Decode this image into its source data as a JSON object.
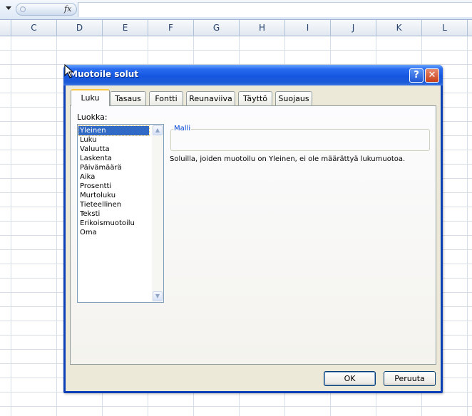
{
  "formula_bar": {
    "fx_label": "fx",
    "value": ""
  },
  "columns": [
    {
      "label": "C"
    },
    {
      "label": "D"
    },
    {
      "label": "E"
    },
    {
      "label": "F"
    },
    {
      "label": "G"
    },
    {
      "label": "H"
    },
    {
      "label": "I"
    },
    {
      "label": "J"
    },
    {
      "label": "K"
    },
    {
      "label": "L"
    }
  ],
  "dialog": {
    "title": "Muotoile solut",
    "help_glyph": "?",
    "close_glyph": "✕",
    "tabs": [
      {
        "label": "Luku"
      },
      {
        "label": "Tasaus"
      },
      {
        "label": "Fontti"
      },
      {
        "label": "Reunaviiva"
      },
      {
        "label": "Täyttö"
      },
      {
        "label": "Suojaus"
      }
    ],
    "category_label": "Luokka:",
    "categories": [
      {
        "label": "Yleinen"
      },
      {
        "label": "Luku"
      },
      {
        "label": "Valuutta"
      },
      {
        "label": "Laskenta"
      },
      {
        "label": "Päivämäärä"
      },
      {
        "label": "Aika"
      },
      {
        "label": "Prosentti"
      },
      {
        "label": "Murtoluku"
      },
      {
        "label": "Tieteellinen"
      },
      {
        "label": "Teksti"
      },
      {
        "label": "Erikoismuotoilu"
      },
      {
        "label": "Oma"
      }
    ],
    "selected_category": "Yleinen",
    "sample_label": "Malli",
    "description": "Soluilla, joiden muotoilu on Yleinen, ei ole määrättyä lukumuotoa.",
    "ok_label": "OK",
    "cancel_label": "Peruuta"
  },
  "colors": {
    "title_bar": "#1556e0",
    "selection": "#316ac5",
    "dialog_face": "#ece9d8"
  }
}
